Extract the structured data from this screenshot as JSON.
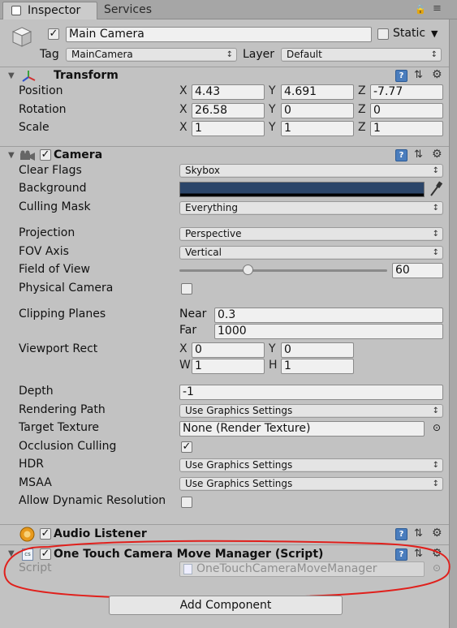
{
  "tabs": {
    "inspector": "Inspector",
    "services": "Services"
  },
  "gameobject": {
    "name": "Main Camera",
    "static_label": "Static",
    "tag_label": "Tag",
    "tag": "MainCamera",
    "layer_label": "Layer",
    "layer": "Default"
  },
  "transform": {
    "title": "Transform",
    "position_label": "Position",
    "rotation_label": "Rotation",
    "scale_label": "Scale",
    "x_axis": "X",
    "y_axis": "Y",
    "z_axis": "Z",
    "position": {
      "x": "4.43",
      "y": "4.691",
      "z": "-7.77"
    },
    "rotation": {
      "x": "26.58",
      "y": "0",
      "z": "0"
    },
    "scale": {
      "x": "1",
      "y": "1",
      "z": "1"
    }
  },
  "camera": {
    "title": "Camera",
    "clear_flags_label": "Clear Flags",
    "clear_flags": "Skybox",
    "background_label": "Background",
    "background_color": "#2b4569",
    "culling_mask_label": "Culling Mask",
    "culling_mask": "Everything",
    "projection_label": "Projection",
    "projection": "Perspective",
    "fov_axis_label": "FOV Axis",
    "fov_axis": "Vertical",
    "fov_label": "Field of View",
    "fov": "60",
    "fov_slider_fraction": 0.33,
    "physical_label": "Physical Camera",
    "clipping_label": "Clipping Planes",
    "near_label": "Near",
    "near": "0.3",
    "far_label": "Far",
    "far": "1000",
    "viewport_label": "Viewport Rect",
    "x_label": "X",
    "y_label": "Y",
    "w_label": "W",
    "h_label": "H",
    "viewport": {
      "x": "0",
      "y": "0",
      "w": "1",
      "h": "1"
    },
    "depth_label": "Depth",
    "depth": "-1",
    "rendering_path_label": "Rendering Path",
    "rendering_path": "Use Graphics Settings",
    "target_texture_label": "Target Texture",
    "target_texture": "None (Render Texture)",
    "occlusion_label": "Occlusion Culling",
    "hdr_label": "HDR",
    "hdr": "Use Graphics Settings",
    "msaa_label": "MSAA",
    "msaa": "Use Graphics Settings",
    "dynamic_res_label": "Allow Dynamic Resolution"
  },
  "audio_listener": {
    "title": "Audio Listener"
  },
  "script_component": {
    "title": "One Touch Camera Move Manager (Script)",
    "script_label": "Script",
    "script_value": "OneTouchCameraMoveManager"
  },
  "add_component": "Add Component",
  "colors": {
    "highlight_ellipse": "#e0201c",
    "help_icon": "#4a7dbd"
  }
}
